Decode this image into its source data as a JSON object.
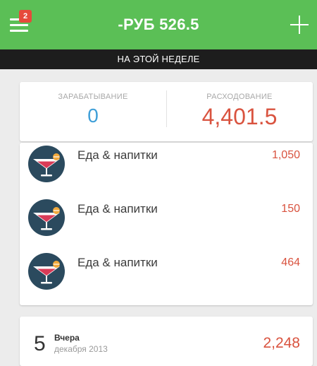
{
  "header": {
    "title": "-РУБ 526.5",
    "badge": "2",
    "menu_icon": "menu-icon",
    "add_icon": "plus-icon"
  },
  "period": {
    "label": "НА ЭТОЙ НЕДЕЛЕ"
  },
  "summary": {
    "earning_label": "ЗАРАБАТЫВАНИЕ",
    "earning_value": "0",
    "spending_label": "РАСХОДОВАНИЕ",
    "spending_value": "4,401.5"
  },
  "transactions": [
    {
      "category": "Еда & напитки",
      "amount": "1,050",
      "icon": "cocktail-icon"
    },
    {
      "category": "Еда & напитки",
      "amount": "150",
      "icon": "cocktail-icon"
    },
    {
      "category": "Еда & напитки",
      "amount": "464",
      "icon": "cocktail-icon"
    }
  ],
  "day_group": {
    "day": "5",
    "day_name": "Вчера",
    "month_year": "декабря 2013",
    "total": "2,248"
  },
  "colors": {
    "header_bg": "#5bbf56",
    "period_bg": "#1d1d1d",
    "badge": "#e64a3b",
    "earning": "#3f9fd8",
    "spending": "#d9533f",
    "icon_bg": "#2b4a5e"
  }
}
